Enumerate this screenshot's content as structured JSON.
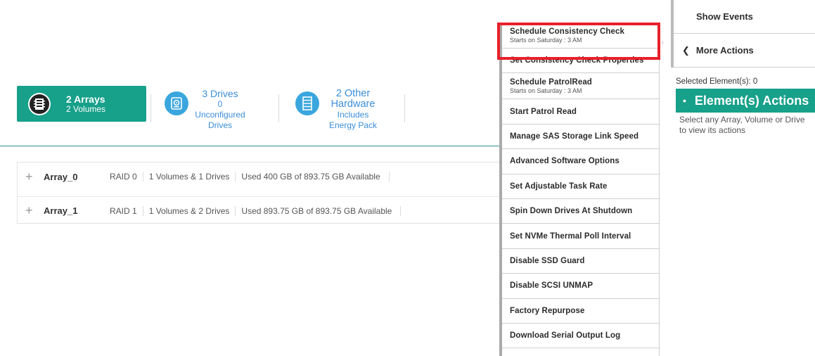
{
  "summary": {
    "arrays": {
      "line1": "2 Arrays",
      "line2": "2 Volumes",
      "icon": "array-chip-icon"
    },
    "drives": {
      "line1": "3 Drives",
      "line2": "0",
      "line3": "Unconfigured",
      "line4": "Drives",
      "icon": "drive-icon"
    },
    "hardware": {
      "line1": "2 Other",
      "line2": "Hardware",
      "line3": "Includes",
      "line4": "Energy Pack",
      "icon": "hardware-stack-icon"
    }
  },
  "arrays": [
    {
      "name": "Array_0",
      "raid": "RAID 0",
      "members": "1 Volumes & 1 Drives",
      "usage": "Used 400 GB of 893.75 GB Available"
    },
    {
      "name": "Array_1",
      "raid": "RAID 1",
      "members": "1 Volumes & 2 Drives",
      "usage": "Used 893.75 GB of 893.75 GB Available"
    }
  ],
  "menu": [
    {
      "label": "Schedule Consistency Check",
      "sub": "Starts on Saturday : 3 AM"
    },
    {
      "label": "Set Consistency Check Properties"
    },
    {
      "label": "Schedule PatrolRead",
      "sub": "Starts on Saturday : 3 AM"
    },
    {
      "label": "Start Patrol Read"
    },
    {
      "label": "Manage SAS Storage Link Speed"
    },
    {
      "label": "Advanced Software Options"
    },
    {
      "label": "Set Adjustable Task Rate"
    },
    {
      "label": "Spin Down Drives At Shutdown"
    },
    {
      "label": "Set NVMe Thermal Poll Interval"
    },
    {
      "label": "Disable SSD Guard"
    },
    {
      "label": "Disable SCSI UNMAP"
    },
    {
      "label": "Factory Repurpose"
    },
    {
      "label": "Download Serial Output Log"
    }
  ],
  "right_panel": {
    "show_events": "Show Events",
    "more_actions": "More Actions",
    "selected": "Selected Element(s): 0",
    "element_actions": "Element(s) Actions",
    "description": "Select any Array, Volume or Drive to view its actions"
  },
  "colors": {
    "accent": "#17a08a",
    "link": "#3b8ed8",
    "highlight": "#e8202a"
  }
}
